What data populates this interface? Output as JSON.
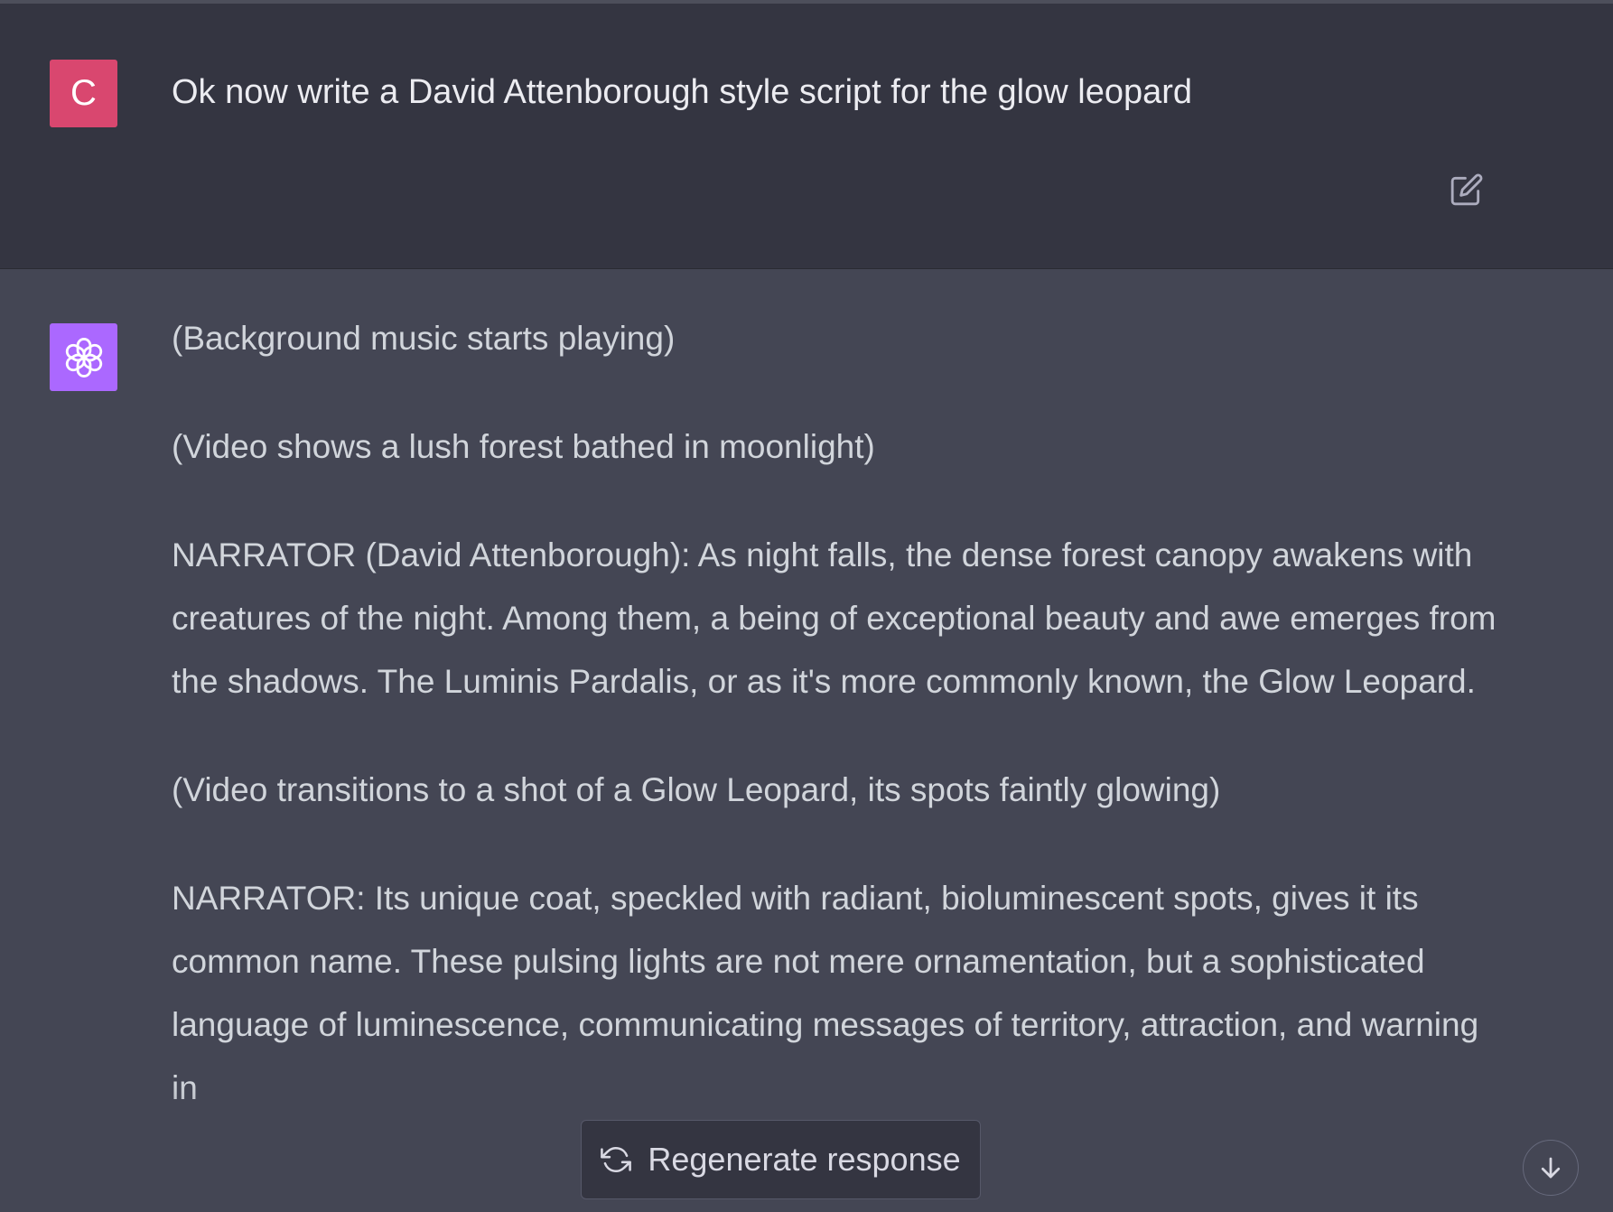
{
  "user_message": {
    "avatar_letter": "C",
    "avatar_color": "#d9476f",
    "text": "Ok now write a David Attenborough style script for the glow leopard",
    "edit_icon": "edit-icon"
  },
  "assistant_message": {
    "avatar_color": "#ab68ff",
    "avatar_icon": "openai-logo-icon",
    "paragraphs": [
      "(Background music starts playing)",
      "(Video shows a lush forest bathed in moonlight)",
      "NARRATOR (David Attenborough): As night falls, the dense forest canopy awakens with creatures of the night. Among them, a being of exceptional beauty and awe emerges from the shadows. The Luminis Pardalis, or as it's more commonly known, the Glow Leopard.",
      "(Video transitions to a shot of a Glow Leopard, its spots faintly glowing)",
      "NARRATOR: Its unique coat, speckled with radiant, bioluminescent spots, gives it its common name. These pulsing lights are not mere ornamentation, but a sophisticated language of luminescence, communicating messages of territory, attraction, and warning in"
    ]
  },
  "controls": {
    "regenerate_label": "Regenerate response",
    "regenerate_icon": "refresh-icon",
    "scroll_down_icon": "arrow-down-icon"
  },
  "colors": {
    "user_bg": "#343541",
    "assistant_bg": "#444654",
    "text": "#d1d5db"
  }
}
